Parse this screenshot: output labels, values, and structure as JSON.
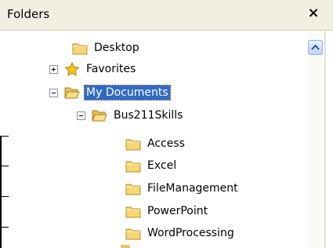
{
  "panel": {
    "title": "Folders",
    "close_label": "×"
  },
  "tree": [
    {
      "label": "Desktop",
      "icon": "desktop-folder-icon",
      "expander": "none",
      "selected": false
    },
    {
      "label": "Favorites",
      "icon": "star-icon",
      "expander": "plus",
      "selected": false
    },
    {
      "label": "My Documents",
      "icon": "open-folder-icon",
      "expander": "minus",
      "selected": true
    },
    {
      "label": "Bus211Skills",
      "icon": "open-folder-icon",
      "expander": "minus",
      "selected": false
    },
    {
      "label": "Access",
      "icon": "folder-icon",
      "expander": "none",
      "selected": false
    },
    {
      "label": "Excel",
      "icon": "folder-icon",
      "expander": "none",
      "selected": false
    },
    {
      "label": "FileManagement",
      "icon": "folder-icon",
      "expander": "none",
      "selected": false
    },
    {
      "label": "PowerPoint",
      "icon": "folder-icon",
      "expander": "none",
      "selected": false
    },
    {
      "label": "WordProcessing",
      "icon": "folder-icon",
      "expander": "none",
      "selected": false
    }
  ]
}
